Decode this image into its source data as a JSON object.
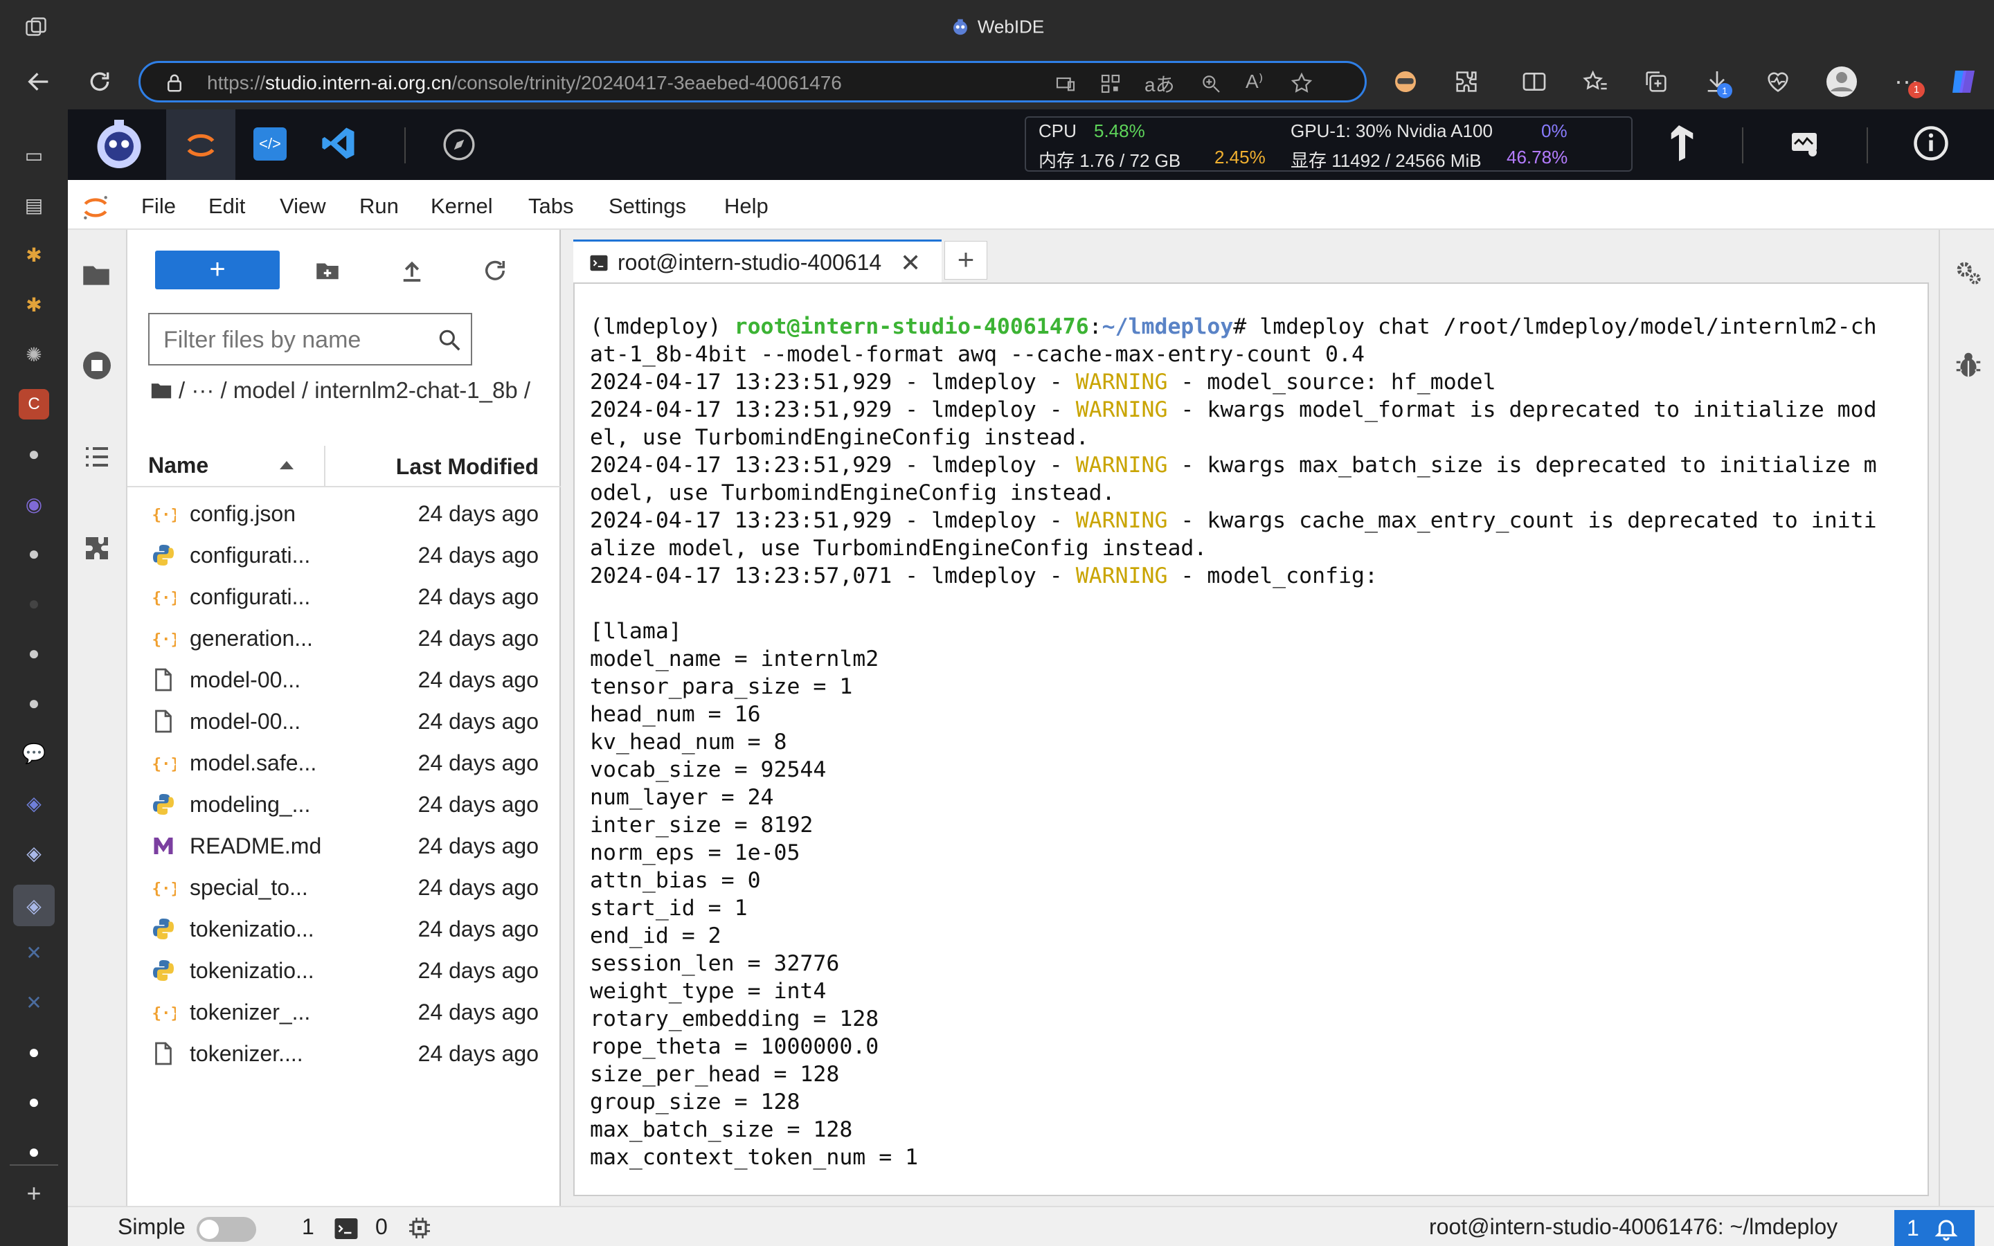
{
  "window": {
    "title": "WebIDE"
  },
  "browser": {
    "url_prefix": "https://",
    "url_host": "studio.intern-ai.org.cn",
    "url_path": "/console/trinity/20240417-3eaebed-40061476",
    "download_badge": "1",
    "notif_badge": "1"
  },
  "stats": {
    "cpu_label": "CPU",
    "cpu_value": "5.48%",
    "gpu_label": "GPU-1: 30% Nvidia A100",
    "gpu_value": "0%",
    "mem_label": "内存 1.76 / 72 GB",
    "mem_value": "2.45%",
    "vram_label": "显存 11492 / 24566 MiB",
    "vram_value": "46.78%"
  },
  "menu": {
    "file": "File",
    "edit": "Edit",
    "view": "View",
    "run": "Run",
    "kernel": "Kernel",
    "tabs": "Tabs",
    "settings": "Settings",
    "help": "Help"
  },
  "filebrowser": {
    "new_label": "+",
    "filter_placeholder": "Filter files by name",
    "breadcrumb": "/  ···  / model / internlm2-chat-1_8b /",
    "col_name": "Name",
    "col_modified": "Last Modified",
    "files": [
      {
        "name": "config.json",
        "type": "json",
        "modified": "24 days ago"
      },
      {
        "name": "configurati...",
        "type": "python",
        "modified": "24 days ago"
      },
      {
        "name": "configurati...",
        "type": "json",
        "modified": "24 days ago"
      },
      {
        "name": "generation...",
        "type": "json",
        "modified": "24 days ago"
      },
      {
        "name": "model-00...",
        "type": "file",
        "modified": "24 days ago"
      },
      {
        "name": "model-00...",
        "type": "file",
        "modified": "24 days ago"
      },
      {
        "name": "model.safe...",
        "type": "json",
        "modified": "24 days ago"
      },
      {
        "name": "modeling_...",
        "type": "python",
        "modified": "24 days ago"
      },
      {
        "name": "README.md",
        "type": "markdown",
        "modified": "24 days ago"
      },
      {
        "name": "special_to...",
        "type": "json",
        "modified": "24 days ago"
      },
      {
        "name": "tokenizatio...",
        "type": "python",
        "modified": "24 days ago"
      },
      {
        "name": "tokenizatio...",
        "type": "python",
        "modified": "24 days ago"
      },
      {
        "name": "tokenizer_...",
        "type": "json",
        "modified": "24 days ago"
      },
      {
        "name": "tokenizer....",
        "type": "file",
        "modified": "24 days ago"
      }
    ]
  },
  "terminal": {
    "tab_label": "root@intern-studio-400614",
    "prompt_env": "(lmdeploy) ",
    "prompt_user": "root@intern-studio-40061476",
    "prompt_sep": ":",
    "prompt_path": "~/lmdeploy",
    "command": "# lmdeploy chat /root/lmdeploy/model/internlm2-ch\nat-1_8b-4bit --model-format awq --cache-max-entry-count 0.4",
    "log_prefix_1": "2024-04-17 13:23:51,929 - lmdeploy - ",
    "log_prefix_2": "2024-04-17 13:23:57,071 - lmdeploy - ",
    "warn": "WARNING",
    "log1": " - model_source: hf_model",
    "log2": " - kwargs model_format is deprecated to initialize mod\nel, use TurbomindEngineConfig instead.",
    "log3": " - kwargs max_batch_size is deprecated to initialize m\nodel, use TurbomindEngineConfig instead.",
    "log4": " - kwargs cache_max_entry_count is deprecated to initi\nalize model, use TurbomindEngineConfig instead.",
    "log5": " - model_config:",
    "config": "\n[llama]\nmodel_name = internlm2\ntensor_para_size = 1\nhead_num = 16\nkv_head_num = 8\nvocab_size = 92544\nnum_layer = 24\ninter_size = 8192\nnorm_eps = 1e-05\nattn_bias = 0\nstart_id = 1\nend_id = 2\nsession_len = 32776\nweight_type = int4\nrotary_embedding = 128\nrope_theta = 1000000.0\nsize_per_head = 128\ngroup_size = 128\nmax_batch_size = 128\nmax_context_token_num = 1"
  },
  "statusbar": {
    "mode_label": "Simple",
    "kernels_count": "1",
    "terminals_count": "0",
    "location": "root@intern-studio-40061476: ~/lmdeploy",
    "notifications": "1"
  },
  "colors": {
    "accent": "#1f74d6",
    "jupyter_orange": "#f37726",
    "warning": "#c9a400",
    "prompt_green": "#3cb334"
  }
}
